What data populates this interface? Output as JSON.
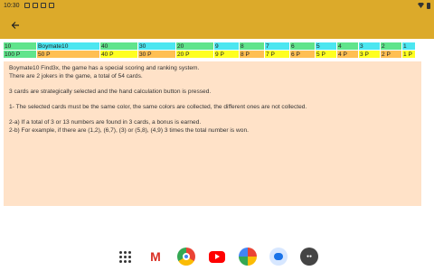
{
  "status": {
    "time": "10:30"
  },
  "grid": {
    "top": [
      {
        "label": "10",
        "w": 37,
        "bg": "g"
      },
      {
        "label": "Boymate10",
        "w": 70,
        "bg": "c"
      },
      {
        "label": "40",
        "w": 42,
        "bg": "g"
      },
      {
        "label": "30",
        "w": 42,
        "bg": "c"
      },
      {
        "label": "20",
        "w": 42,
        "bg": "g"
      },
      {
        "label": "9",
        "w": 28,
        "bg": "c"
      },
      {
        "label": "8",
        "w": 28,
        "bg": "g"
      },
      {
        "label": "7",
        "w": 28,
        "bg": "c"
      },
      {
        "label": "6",
        "w": 28,
        "bg": "g"
      },
      {
        "label": "5",
        "w": 24,
        "bg": "c"
      },
      {
        "label": "4",
        "w": 24,
        "bg": "g"
      },
      {
        "label": "3",
        "w": 24,
        "bg": "c"
      },
      {
        "label": "2",
        "w": 24,
        "bg": "g"
      },
      {
        "label": "1",
        "w": 15,
        "bg": "c"
      }
    ],
    "bottom": [
      {
        "label": "100 P",
        "w": 37,
        "bg": "g"
      },
      {
        "label": "50 P",
        "w": 70,
        "bg": "o"
      },
      {
        "label": "40 P",
        "w": 42,
        "bg": "y"
      },
      {
        "label": "30 P",
        "w": 42,
        "bg": "o"
      },
      {
        "label": "20 P",
        "w": 42,
        "bg": "y"
      },
      {
        "label": "9 P",
        "w": 28,
        "bg": "y"
      },
      {
        "label": "8 P",
        "w": 28,
        "bg": "o"
      },
      {
        "label": "7 P",
        "w": 28,
        "bg": "y"
      },
      {
        "label": "6 P",
        "w": 28,
        "bg": "o"
      },
      {
        "label": "5 P",
        "w": 24,
        "bg": "y"
      },
      {
        "label": "4 P",
        "w": 24,
        "bg": "o"
      },
      {
        "label": "3 P",
        "w": 24,
        "bg": "y"
      },
      {
        "label": "2 P",
        "w": 24,
        "bg": "o"
      },
      {
        "label": "1 P",
        "w": 15,
        "bg": "y"
      }
    ]
  },
  "info": {
    "line1": "Boymate10 Find3x, the game has a special scoring and ranking system.",
    "line2": "There are 2 jokers in the game, a total of 54 cards.",
    "line3": "3 cards are strategically selected and the hand calculation button is pressed.",
    "line4": "1- The selected cards must be the same color, the same colors are collected, the different ones are not collected.",
    "line5": "2-a) If a total of 3 or 13 numbers are found in 3 cards, a bonus is earned.",
    "line6": "2-b) For example, if there are (1,2), (6,7), (3) or (5,8), (4,9) 3 times the total number is won."
  }
}
